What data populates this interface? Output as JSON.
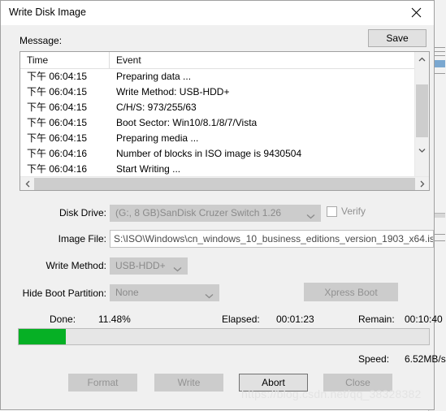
{
  "window": {
    "title": "Write Disk Image",
    "close_icon": "close-icon"
  },
  "message": {
    "label": "Message:",
    "save_label": "Save",
    "columns": {
      "time": "Time",
      "event": "Event"
    },
    "rows": [
      {
        "time": "下午 06:04:15",
        "event": "Preparing data ..."
      },
      {
        "time": "下午 06:04:15",
        "event": "Write Method: USB-HDD+"
      },
      {
        "time": "下午 06:04:15",
        "event": "C/H/S: 973/255/63"
      },
      {
        "time": "下午 06:04:15",
        "event": "Boot Sector: Win10/8.1/8/7/Vista"
      },
      {
        "time": "下午 06:04:15",
        "event": "Preparing media ..."
      },
      {
        "time": "下午 06:04:16",
        "event": "Number of blocks in ISO image is 9430504"
      },
      {
        "time": "下午 06:04:16",
        "event": "Start Writing ..."
      }
    ]
  },
  "form": {
    "disk_drive": {
      "label": "Disk Drive:",
      "value": "(G:, 8 GB)SanDisk Cruzer Switch   1.26"
    },
    "verify": {
      "label": "Verify",
      "checked": false
    },
    "image_file": {
      "label": "Image File:",
      "value": "S:\\ISO\\Windows\\cn_windows_10_business_editions_version_1903_x64.is"
    },
    "write_method": {
      "label": "Write Method:",
      "value": "USB-HDD+"
    },
    "hide_boot_partition": {
      "label": "Hide Boot Partition:",
      "value": "None"
    },
    "xpress_boot_label": "Xpress Boot"
  },
  "status": {
    "done_label": "Done:",
    "done_value": "11.48%",
    "elapsed_label": "Elapsed:",
    "elapsed_value": "00:01:23",
    "remain_label": "Remain:",
    "remain_value": "00:10:40",
    "speed_label": "Speed:",
    "speed_value": "6.52MB/s",
    "progress_percent": 11.48
  },
  "buttons": {
    "format": "Format",
    "write": "Write",
    "abort": "Abort",
    "close": "Close"
  },
  "watermark": "https://blog.csdn.net/qq_38328382",
  "colors": {
    "progress_green": "#06b025",
    "dialog_bg": "#f0f0f0",
    "disabled_gray": "#cccccc"
  }
}
